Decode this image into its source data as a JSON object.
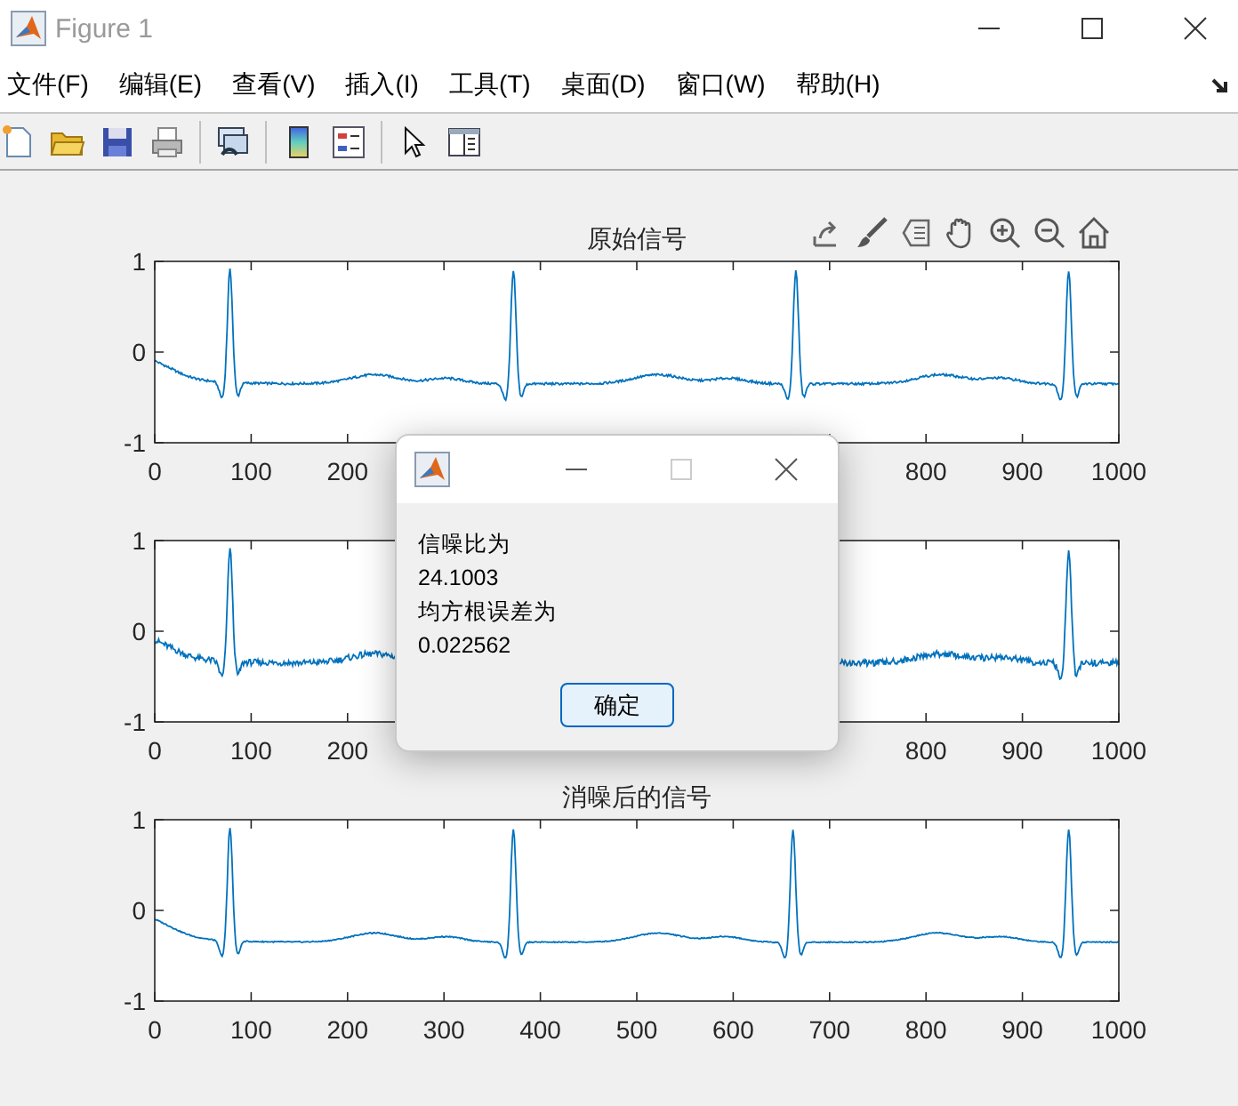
{
  "window": {
    "title": "Figure 1"
  },
  "menu": [
    "文件(F)",
    "编辑(E)",
    "查看(V)",
    "插入(I)",
    "工具(T)",
    "桌面(D)",
    "窗口(W)",
    "帮助(H)"
  ],
  "plots": [
    {
      "chart_data": {
        "type": "line",
        "title": "原始信号",
        "xlim": [
          0,
          1000
        ],
        "ylim": [
          -1,
          1
        ],
        "xticks": [
          0,
          100,
          200,
          800,
          900,
          1000
        ],
        "yticks": [
          -1,
          0,
          1
        ]
      },
      "axes_toolbar": true
    },
    {
      "chart_data": {
        "type": "line",
        "xlim": [
          0,
          1000
        ],
        "ylim": [
          -1,
          1
        ],
        "xticks": [
          0,
          100,
          200,
          800,
          900,
          1000
        ],
        "yticks": [
          -1,
          0,
          1
        ]
      },
      "axes_toolbar": false
    },
    {
      "chart_data": {
        "type": "line",
        "title": "消噪后的信号",
        "xlim": [
          0,
          1000
        ],
        "ylim": [
          -1,
          1
        ],
        "xticks": [
          0,
          100,
          200,
          300,
          400,
          500,
          600,
          700,
          800,
          900,
          1000
        ],
        "yticks": [
          -1,
          0,
          1
        ]
      },
      "axes_toolbar": false
    }
  ],
  "dialog": {
    "lines": [
      "信噪比为",
      "24.1003",
      "均方根误差为",
      "0.022562"
    ],
    "button": "确定"
  }
}
